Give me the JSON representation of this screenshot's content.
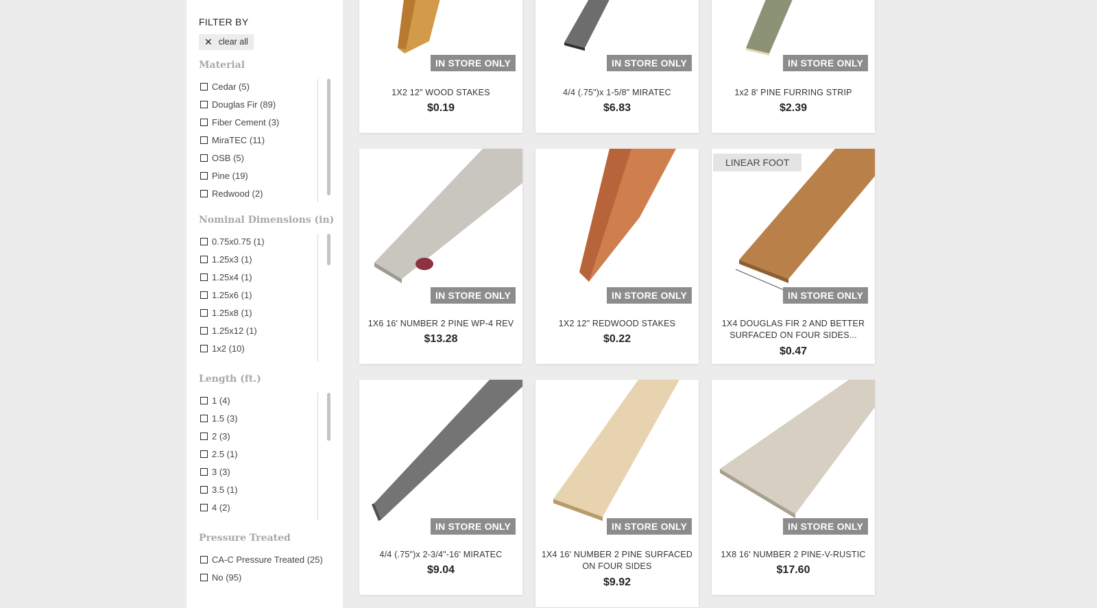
{
  "filters": {
    "heading": "FILTER BY",
    "clear_label": "clear all",
    "groups": [
      {
        "title": "Material",
        "options": [
          "Cedar (5)",
          "Douglas Fir (89)",
          "Fiber Cement (3)",
          "MiraTEC (11)",
          "OSB (5)",
          "Pine (19)",
          "Redwood (2)"
        ]
      },
      {
        "title": "Nominal Dimensions (in)",
        "options": [
          "0.75x0.75 (1)",
          "1.25x3 (1)",
          "1.25x4 (1)",
          "1.25x6 (1)",
          "1.25x8 (1)",
          "1.25x12 (1)",
          "1x2 (10)"
        ]
      },
      {
        "title": "Length (ft.)",
        "options": [
          "1 (4)",
          "1.5 (3)",
          "2 (3)",
          "2.5 (1)",
          "3 (3)",
          "3.5 (1)",
          "4 (2)"
        ]
      },
      {
        "title": "Pressure Treated",
        "options": [
          "CA-C Pressure Treated (25)",
          "No (95)"
        ]
      }
    ]
  },
  "badges": {
    "in_store": "IN STORE ONLY",
    "linear_foot": "LINEAR FOOT"
  },
  "products": [
    {
      "title": "1X2 12\" WOOD STAKES",
      "price": "$0.19",
      "image": "cedar-stake"
    },
    {
      "title": "4/4 (.75\")x 1-5/8\" MIRATEC",
      "price": "$6.83",
      "image": "gray-trim"
    },
    {
      "title": "1x2 8' PINE FURRING STRIP",
      "price": "$2.39",
      "image": "green-strip"
    },
    {
      "title": "1X6 16' NUMBER 2 PINE WP-4 REV",
      "price": "$13.28",
      "image": "pine-board-knot"
    },
    {
      "title": "1X2 12\" REDWOOD STAKES",
      "price": "$0.22",
      "image": "redwood-stake"
    },
    {
      "title": "1X4 DOUGLAS FIR 2 AND BETTER SURFACED ON FOUR SIDES...",
      "price": "$0.47",
      "image": "douglas-fir-board"
    },
    {
      "title": "4/4 (.75\")x 2-3/4\"-16' MIRATEC",
      "price": "$9.04",
      "image": "gray-plank"
    },
    {
      "title": "1X4 16' NUMBER 2 PINE SURFACED ON FOUR SIDES",
      "price": "$9.92",
      "image": "light-pine-board"
    },
    {
      "title": "1X8 16' NUMBER 2 PINE-V-RUSTIC",
      "price": "$17.60",
      "image": "pine-v-rustic"
    }
  ]
}
